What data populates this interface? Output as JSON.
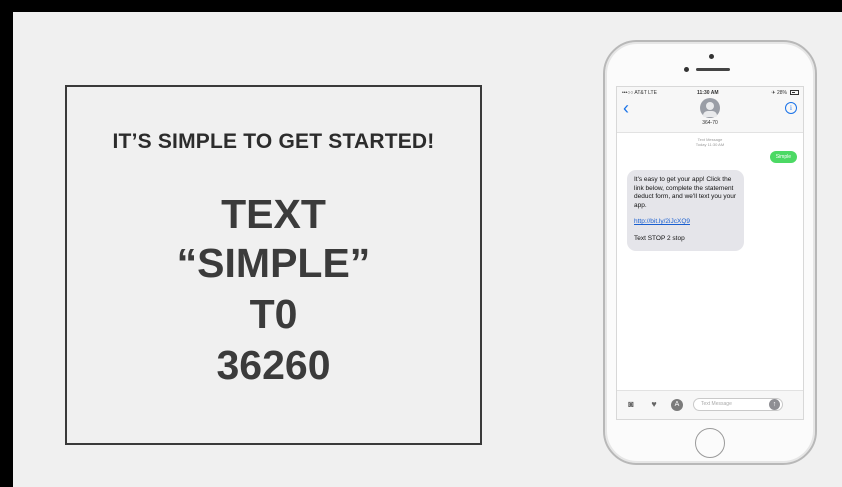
{
  "info": {
    "headline": "IT’S SIMPLE TO GET STARTED!",
    "line1": "TEXT",
    "line2": "“SIMPLE”",
    "line3": "T0",
    "line4": "36260"
  },
  "phone": {
    "status": {
      "carrier": "•••○○ AT&T  LTE",
      "time": "11:30 AM",
      "battery": "✈ 28%"
    },
    "header": {
      "back_glyph": "‹",
      "contact_name": "364-70",
      "info_glyph": "i"
    },
    "thread_label_1": "Text Message",
    "thread_label_2": "Today 11:30 AM",
    "sent_message": "Simple",
    "received": {
      "para1": "It's easy to get your app! Click the link below, complete the statement deduct form, and we'll text you your app.",
      "link": "http://bit.ly/2iJcXQ9",
      "para3": "Text STOP 2 stop"
    },
    "input": {
      "placeholder": "Text Message",
      "camera_glyph": "◙",
      "heart_glyph": "♥",
      "apps_glyph": "A",
      "send_glyph": "↑"
    }
  },
  "icons": [
    "camera-icon",
    "heart-icon",
    "appstore-icon",
    "send-icon",
    "back-icon",
    "info-icon"
  ],
  "colors": {
    "background": "#f0f0f0",
    "frame": "#000000",
    "sent_bubble": "#4cd964",
    "received_bubble": "#e5e5ea",
    "ios_blue": "#1a73e8"
  }
}
